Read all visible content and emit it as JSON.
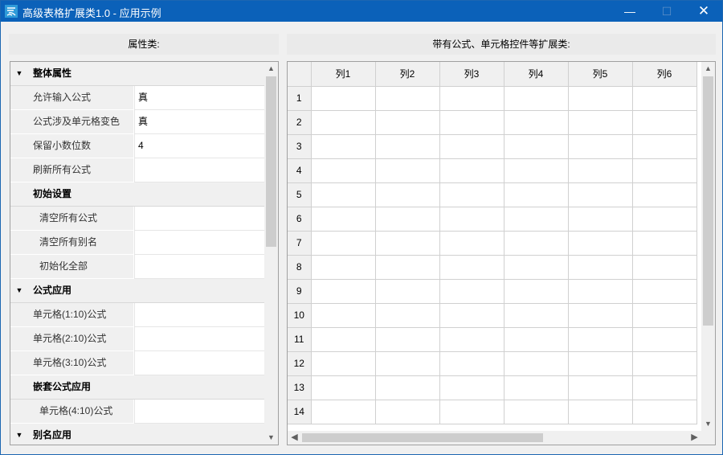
{
  "window": {
    "title": "高级表格扩展类1.0 - 应用示例",
    "controls": {
      "minimize": "—",
      "maximize": "☐",
      "close": "✕"
    }
  },
  "left_panel": {
    "header": "属性类:",
    "rows": [
      {
        "type": "category",
        "label": "整体属性",
        "expand_icon": "triangle-down"
      },
      {
        "type": "property",
        "name": "允许输入公式",
        "value": "真"
      },
      {
        "type": "property",
        "name": "公式涉及单元格变色",
        "value": "真"
      },
      {
        "type": "property",
        "name": "保留小数位数",
        "value": "4"
      },
      {
        "type": "property",
        "name": "刷新所有公式",
        "value": ""
      },
      {
        "type": "category",
        "label": "初始设置",
        "expand_icon": ""
      },
      {
        "type": "property",
        "name": "清空所有公式",
        "value": "",
        "indent": true
      },
      {
        "type": "property",
        "name": "清空所有别名",
        "value": "",
        "indent": true
      },
      {
        "type": "property",
        "name": "初始化全部",
        "value": "",
        "indent": true
      },
      {
        "type": "category",
        "label": "公式应用",
        "expand_icon": "triangle-down"
      },
      {
        "type": "property",
        "name": "单元格(1:10)公式",
        "value": ""
      },
      {
        "type": "property",
        "name": "单元格(2:10)公式",
        "value": ""
      },
      {
        "type": "property",
        "name": "单元格(3:10)公式",
        "value": ""
      },
      {
        "type": "category",
        "label": "嵌套公式应用",
        "expand_icon": ""
      },
      {
        "type": "property",
        "name": "单元格(4:10)公式",
        "value": "",
        "indent": true
      },
      {
        "type": "category",
        "label": "别名应用",
        "expand_icon": "triangle-down"
      }
    ],
    "scroll_position": 0
  },
  "right_panel": {
    "header": "带有公式、单元格控件等扩展类:",
    "columns": [
      "列1",
      "列2",
      "列3",
      "列4",
      "列5",
      "列6"
    ],
    "rows": [
      "1",
      "2",
      "3",
      "4",
      "5",
      "6",
      "7",
      "8",
      "9",
      "10",
      "11",
      "12",
      "13",
      "14"
    ]
  },
  "icons": {
    "scroll_up": "▲",
    "scroll_down": "▼",
    "scroll_left": "◀",
    "scroll_right": "▶",
    "expand": "▼"
  },
  "colors": {
    "titlebar": "#0b61b9",
    "panel": "#f0f0f0"
  }
}
